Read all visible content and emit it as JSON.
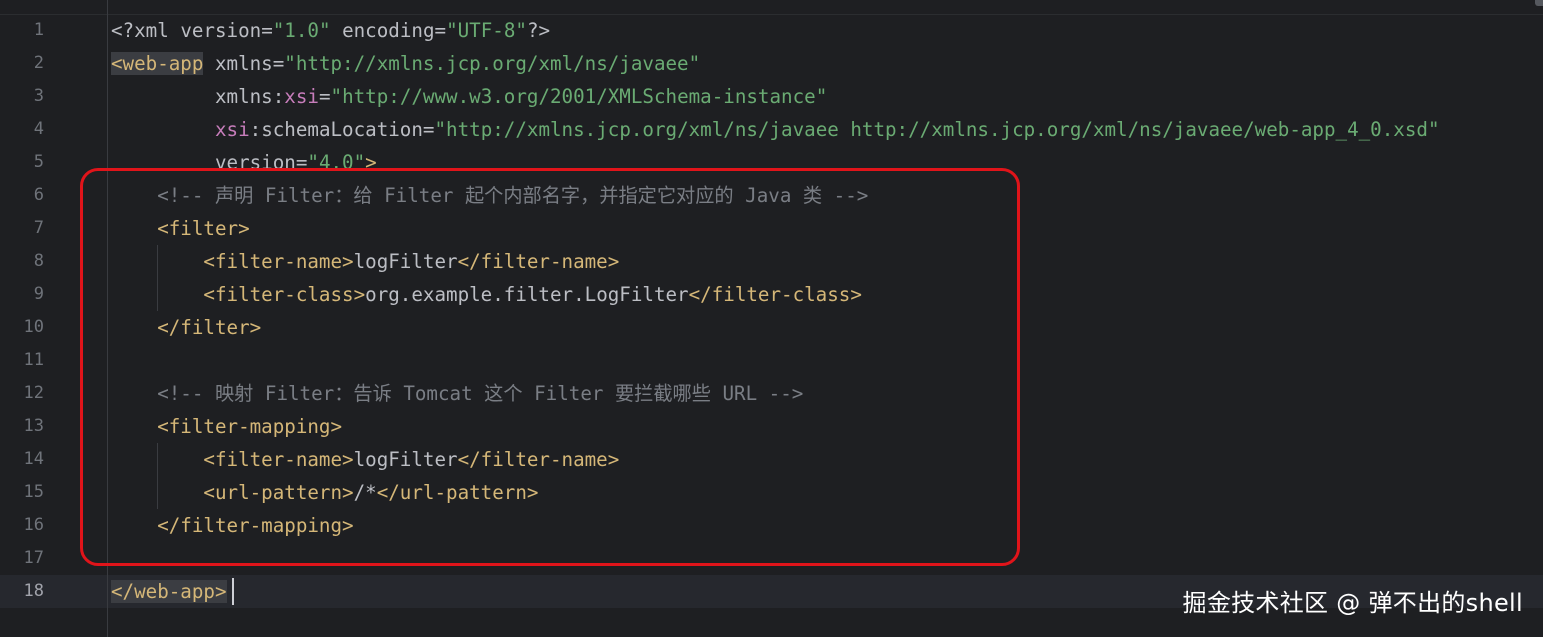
{
  "editor": {
    "line_numbers": [
      "1",
      "2",
      "3",
      "4",
      "5",
      "6",
      "7",
      "8",
      "9",
      "10",
      "11",
      "12",
      "13",
      "14",
      "15",
      "16",
      "17",
      "18"
    ],
    "active_line": "18",
    "lines": [
      [
        {
          "cls": "pi",
          "t": "<?xml "
        },
        {
          "cls": "attr",
          "t": "version"
        },
        {
          "cls": "pi",
          "t": "="
        },
        {
          "cls": "str",
          "t": "\"1.0\""
        },
        {
          "cls": "pi",
          "t": " "
        },
        {
          "cls": "attr",
          "t": "encoding"
        },
        {
          "cls": "pi",
          "t": "="
        },
        {
          "cls": "str",
          "t": "\"UTF-8\""
        },
        {
          "cls": "pi",
          "t": "?>"
        }
      ],
      [
        {
          "cls": "tag tag-hl",
          "t": "<web-app"
        },
        {
          "cls": "attr",
          "t": " xmlns"
        },
        {
          "cls": "pi",
          "t": "="
        },
        {
          "cls": "str",
          "t": "\"http://xmlns.jcp.org/xml/ns/javaee\""
        }
      ],
      [
        {
          "cls": "attr",
          "t": "         xmlns"
        },
        {
          "cls": "pi",
          "t": ":"
        },
        {
          "cls": "ns",
          "t": "xsi"
        },
        {
          "cls": "pi",
          "t": "="
        },
        {
          "cls": "str",
          "t": "\"http://www.w3.org/2001/XMLSchema-instance\""
        }
      ],
      [
        {
          "cls": "ns",
          "t": "         xsi"
        },
        {
          "cls": "pi",
          "t": ":"
        },
        {
          "cls": "attr",
          "t": "schemaLocation"
        },
        {
          "cls": "pi",
          "t": "="
        },
        {
          "cls": "str",
          "t": "\"http://xmlns.jcp.org/xml/ns/javaee http://xmlns.jcp.org/xml/ns/javaee/web-app_4_0.xsd\""
        }
      ],
      [
        {
          "cls": "attr",
          "t": "         version"
        },
        {
          "cls": "pi",
          "t": "="
        },
        {
          "cls": "str",
          "t": "\"4.0\""
        },
        {
          "cls": "tag",
          "t": ">"
        }
      ],
      [
        {
          "cls": "comment",
          "t": "    <!-- 声明 Filter：给 Filter 起个内部名字，并指定它对应的 Java 类 -->"
        }
      ],
      [
        {
          "cls": "tag",
          "t": "    <filter>"
        }
      ],
      [
        {
          "cls": "tag",
          "t": "        <filter-name>"
        },
        {
          "cls": "text",
          "t": "logFilter"
        },
        {
          "cls": "tag",
          "t": "</filter-name>"
        }
      ],
      [
        {
          "cls": "tag",
          "t": "        <filter-class>"
        },
        {
          "cls": "text",
          "t": "org.example.filter.LogFilter"
        },
        {
          "cls": "tag",
          "t": "</filter-class>"
        }
      ],
      [
        {
          "cls": "tag",
          "t": "    </filter>"
        }
      ],
      [],
      [
        {
          "cls": "comment",
          "t": "    <!-- 映射 Filter：告诉 Tomcat 这个 Filter 要拦截哪些 URL -->"
        }
      ],
      [
        {
          "cls": "tag",
          "t": "    <filter-mapping>"
        }
      ],
      [
        {
          "cls": "tag",
          "t": "        <filter-name>"
        },
        {
          "cls": "text",
          "t": "logFilter"
        },
        {
          "cls": "tag",
          "t": "</filter-name>"
        }
      ],
      [
        {
          "cls": "tag",
          "t": "        <url-pattern>"
        },
        {
          "cls": "text",
          "t": "/*"
        },
        {
          "cls": "tag",
          "t": "</url-pattern>"
        }
      ],
      [
        {
          "cls": "tag",
          "t": "    </filter-mapping>"
        }
      ],
      [],
      [
        {
          "cls": "tag tag-hl",
          "t": "</web-app>"
        }
      ]
    ]
  },
  "watermark": "掘金技术社区 @ 弹不出的shell",
  "colors": {
    "background": "#1e1f22",
    "tag": "#d5b778",
    "string": "#6aab73",
    "namespace": "#c77dbb",
    "comment": "#7a7e85",
    "highlight_box": "#e0141a"
  }
}
